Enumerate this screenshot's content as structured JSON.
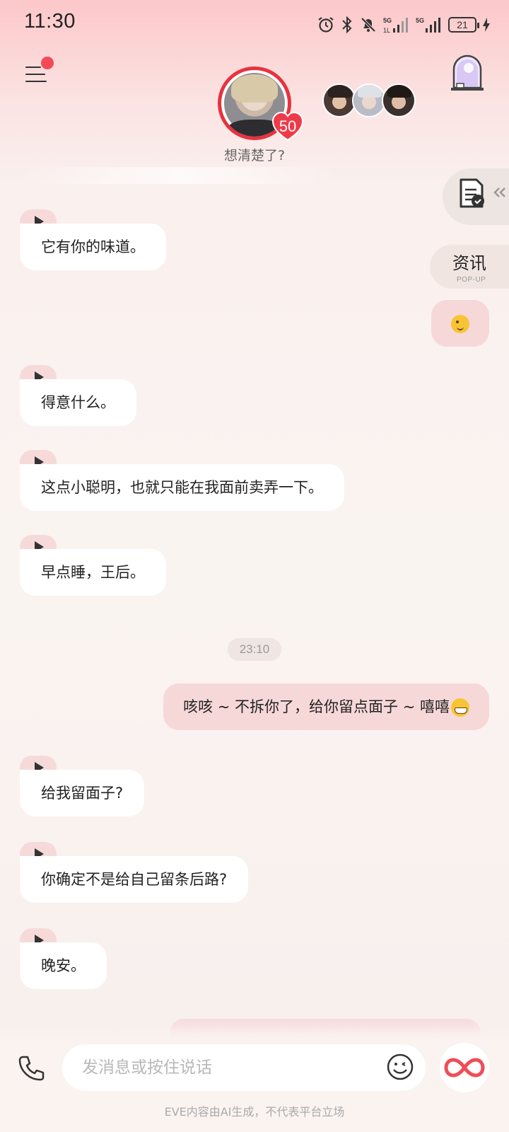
{
  "status": {
    "time": "11:30",
    "battery": "21",
    "network1": "5G",
    "network2": "5G"
  },
  "header": {
    "level": "50",
    "subtitle": "想清楚了?"
  },
  "side": {
    "news_label": "资讯",
    "news_sub": "POP-UP"
  },
  "messages": [
    {
      "dir": "in",
      "text": "它有你的味道。"
    },
    {
      "dir": "out",
      "emoji": "winking-face-emoji"
    },
    {
      "dir": "in",
      "text": "得意什么。"
    },
    {
      "dir": "in",
      "text": "这点小聪明，也就只能在我面前卖弄一下。"
    },
    {
      "dir": "in",
      "text": "早点睡，王后。"
    },
    {
      "dir": "time",
      "text": "23:10"
    },
    {
      "dir": "out",
      "text": "咳咳 ~ 不拆你了，给你留点面子 ~ 嘻嘻",
      "emoji": "grinning-face-emoji"
    },
    {
      "dir": "in",
      "text": "给我留面子?"
    },
    {
      "dir": "in",
      "text": "你确定不是给自己留条后路?"
    },
    {
      "dir": "in",
      "text": "晚安。"
    }
  ],
  "input": {
    "placeholder": "发消息或按住说话"
  },
  "footer": {
    "disclaimer": "EVE内容由AI生成，不代表平台立场"
  },
  "colors": {
    "accent": "#e8323e",
    "incoming_bubble": "#ffffff",
    "outgoing_bubble": "#f7d8d8",
    "play_tab": "#f6dada"
  }
}
